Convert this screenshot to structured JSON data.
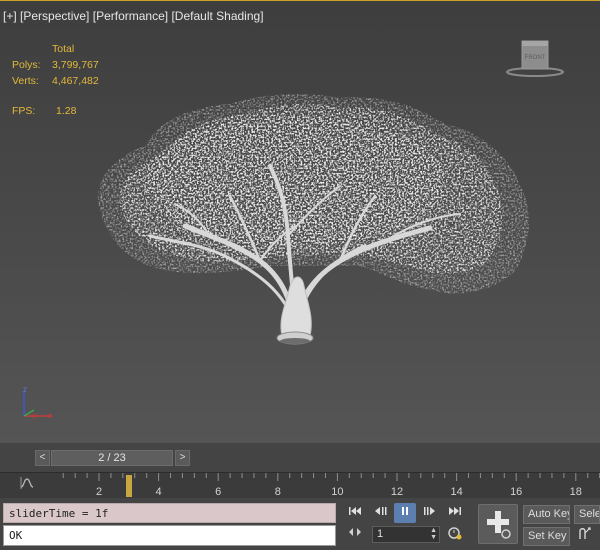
{
  "viewport": {
    "labels": [
      "[+]",
      "[Perspective]",
      "[Performance]",
      "[Default Shading]"
    ],
    "stats": {
      "header": "Total",
      "polys_label": "Polys:",
      "polys_value": "3,799,767",
      "verts_label": "Verts:",
      "verts_value": "4,467,482",
      "fps_label": "FPS:",
      "fps_value": "1.28"
    },
    "viewcube_label": "FRONT",
    "axis": {
      "z": "z",
      "y": "y",
      "x": "x"
    },
    "colors": {
      "stats": "#e2b93b",
      "border": "#c9a227"
    }
  },
  "timeline": {
    "prev_label": "<",
    "next_label": ">",
    "frame_display": "2 / 23",
    "current_frame_fraction": 0.087,
    "ticks": [
      "2",
      "4",
      "6",
      "8",
      "10",
      "12",
      "14",
      "16",
      "18"
    ]
  },
  "script": {
    "output": "sliderTime = 1f",
    "input": "OK"
  },
  "transport": {
    "frame_value": "1",
    "buttons": [
      "go-start",
      "prev-frame",
      "play-pause",
      "next-frame",
      "go-end"
    ]
  },
  "keys": {
    "auto_key": "Auto Key",
    "set_key": "Set Key",
    "selected": "Sele"
  }
}
